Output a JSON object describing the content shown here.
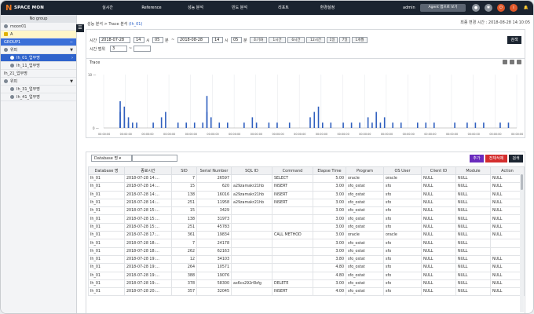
{
  "header": {
    "logo_text": "SPACE MON",
    "menu": [
      "실시간",
      "Reference",
      "성능 분석",
      "빈도 분석",
      "리포트",
      "환경설정"
    ],
    "user": "admin",
    "agent_button": "Agent 앱으로 보기"
  },
  "sidebar": {
    "title": "No group",
    "items": [
      {
        "label": "moon01"
      },
      {
        "label": "A"
      },
      {
        "label": "GROUP1",
        "toggle": "−"
      },
      {
        "label": "위피",
        "toggle": "▼"
      },
      {
        "label": "Ih_01_업무명"
      },
      {
        "label": "Ih_11_업무명"
      },
      {
        "label": "Ih_21_업무명"
      },
      {
        "label": "위피",
        "toggle": "▼"
      },
      {
        "label": "Ih_31_업무명"
      },
      {
        "label": "Ih_41_업무명"
      }
    ]
  },
  "breadcrumb": {
    "prefix": "성능 분석 > Trace 분석",
    "target": "(Ih_01)"
  },
  "updated": "최종 변경 시간 : 2018-08-28 14:10:05",
  "filter": {
    "time_label": "시간",
    "start_date": "2018-07-28",
    "start_hour": "14",
    "start_min": "05",
    "unit_h": "시",
    "unit_m": "분",
    "tilde": "~",
    "end_date": "2018-08-28",
    "end_hour": "14",
    "end_min": "05",
    "quick": [
      "초기화",
      "1시간",
      "6시간",
      "12시간",
      "1일",
      "7일",
      "1개월"
    ],
    "range_label": "시간 범위",
    "range_value": "3",
    "range_tilde": "~",
    "search": "검색"
  },
  "trace": {
    "title": "Trace"
  },
  "chart_data": {
    "type": "scatter",
    "title": "Trace",
    "y_tick": "10 —",
    "zero_tick": "0 —",
    "x_ticks": [
      "00:00:00",
      "00:00:00",
      "00:00:00",
      "00:00:00",
      "00:00:00",
      "00:00:00",
      "00:00:00",
      "00:00:00",
      "00:00:00",
      "00:00:00",
      "00:00:00",
      "00:00:00",
      "00:00:00",
      "00:00:00",
      "00:00:00",
      "00:00:00",
      "00:00:00",
      "00:00:00",
      "00:00:00",
      "00:00:00"
    ],
    "ylim": [
      0,
      10
    ],
    "points": [
      [
        4,
        1
      ],
      [
        4,
        3
      ],
      [
        4,
        5
      ],
      [
        5,
        2
      ],
      [
        5,
        4
      ],
      [
        6,
        1
      ],
      [
        6,
        2
      ],
      [
        7,
        1
      ],
      [
        8,
        1
      ],
      [
        12,
        1
      ],
      [
        14,
        2
      ],
      [
        15,
        3
      ],
      [
        18,
        1
      ],
      [
        20,
        1
      ],
      [
        22,
        1
      ],
      [
        24,
        1
      ],
      [
        25,
        3
      ],
      [
        25,
        6
      ],
      [
        26,
        2
      ],
      [
        28,
        1
      ],
      [
        30,
        1
      ],
      [
        34,
        1
      ],
      [
        36,
        2
      ],
      [
        37,
        1
      ],
      [
        40,
        1
      ],
      [
        42,
        1
      ],
      [
        45,
        1
      ],
      [
        50,
        2
      ],
      [
        51,
        3
      ],
      [
        52,
        4
      ],
      [
        53,
        1
      ],
      [
        55,
        1
      ],
      [
        58,
        1
      ],
      [
        60,
        1
      ],
      [
        62,
        1
      ],
      [
        64,
        2
      ],
      [
        65,
        1
      ],
      [
        66,
        3
      ],
      [
        67,
        1
      ],
      [
        68,
        2
      ],
      [
        70,
        1
      ],
      [
        72,
        1
      ],
      [
        76,
        1
      ],
      [
        78,
        1
      ],
      [
        80,
        1
      ],
      [
        85,
        1
      ],
      [
        88,
        1
      ],
      [
        90,
        1
      ],
      [
        92,
        1
      ],
      [
        96,
        1
      ],
      [
        98,
        1
      ]
    ],
    "grid": true
  },
  "table": {
    "db_select": "Database 명",
    "buttons": {
      "add": "추가",
      "delete_all": "전체삭제",
      "search": "검색"
    },
    "columns": [
      "Database 명",
      "종료시간",
      "SID",
      "Serial Number",
      "SQL ID",
      "Command",
      "Elapse Time",
      "Program",
      "OS User",
      "Client ID",
      "Module",
      "Action"
    ],
    "rows": [
      [
        "Ih_01",
        "2018-07-28 14:…",
        "7",
        "26597",
        "",
        "SELECT",
        "5.00",
        "oracle",
        "oracle",
        "NULL",
        "NULL",
        "NULL"
      ],
      [
        "Ih_01",
        "2018-07-28 14:…",
        "15",
        "620",
        "a29zamakr21hb",
        "INSERT",
        "3.00",
        "sfo_ostat",
        "sfo",
        "NULL",
        "NULL",
        "NULL"
      ],
      [
        "Ih_01",
        "2018-07-28 14:…",
        "138",
        "16016",
        "a29zamakr21hb",
        "INSERT",
        "3.00",
        "sfo_ostat",
        "sfo",
        "NULL",
        "NULL",
        "NULL"
      ],
      [
        "Ih_01",
        "2018-07-28 14:…",
        "251",
        "11958",
        "a29zamakr21hb",
        "INSERT",
        "3.00",
        "sfo_ostat",
        "sfo",
        "NULL",
        "NULL",
        "NULL"
      ],
      [
        "Ih_01",
        "2018-07-28 15:…",
        "15",
        "3429",
        "",
        "",
        "3.00",
        "sfo_ostat",
        "sfo",
        "NULL",
        "NULL",
        "NULL"
      ],
      [
        "Ih_01",
        "2018-07-28 15:…",
        "138",
        "31973",
        "",
        "",
        "3.00",
        "sfo_ostat",
        "sfo",
        "NULL",
        "NULL",
        "NULL"
      ],
      [
        "Ih_01",
        "2018-07-28 15:…",
        "251",
        "45783",
        "",
        "",
        "3.00",
        "sfo_ostat",
        "sfo",
        "NULL",
        "NULL",
        "NULL"
      ],
      [
        "Ih_01",
        "2018-07-28 17:…",
        "361",
        "19834",
        "",
        "CALL METHOD",
        "3.00",
        "oracle",
        "oracle",
        "NULL",
        "NULL",
        "NULL"
      ],
      [
        "Ih_01",
        "2018-07-28 18:…",
        "7",
        "24178",
        "",
        "",
        "3.00",
        "sfo_ostat",
        "sfo",
        "NULL",
        "NULL",
        ""
      ],
      [
        "Ih_01",
        "2018-07-28 18:…",
        "262",
        "62163",
        "",
        "",
        "3.00",
        "sfo_ostat",
        "sfo",
        "NULL",
        "NULL",
        ""
      ],
      [
        "Ih_01",
        "2018-07-28 19:…",
        "12",
        "34103",
        "",
        "",
        "3.80",
        "sfo_ostat",
        "sfo",
        "NULL",
        "NULL",
        "NULL"
      ],
      [
        "Ih_01",
        "2018-07-28 19:…",
        "264",
        "10571",
        "",
        "",
        "4.80",
        "sfo_ostat",
        "sfo",
        "NULL",
        "NULL",
        "NULL"
      ],
      [
        "Ih_01",
        "2018-07-28 19:…",
        "388",
        "19076",
        "",
        "",
        "4.80",
        "sfo_ostat",
        "sfo",
        "NULL",
        "NULL",
        "NULL"
      ],
      [
        "Ih_01",
        "2018-07-28 19:…",
        "378",
        "58300",
        "ax6cs292r0bfg",
        "DELETE",
        "3.00",
        "sfo_ostat",
        "sfo",
        "NULL",
        "NULL",
        "NULL"
      ],
      [
        "Ih_01",
        "2018-07-28 20:…",
        "357",
        "32045",
        "",
        "INSERT",
        "4.00",
        "sfo_ostat",
        "sfo",
        "NULL",
        "NULL",
        "NULL"
      ]
    ]
  }
}
